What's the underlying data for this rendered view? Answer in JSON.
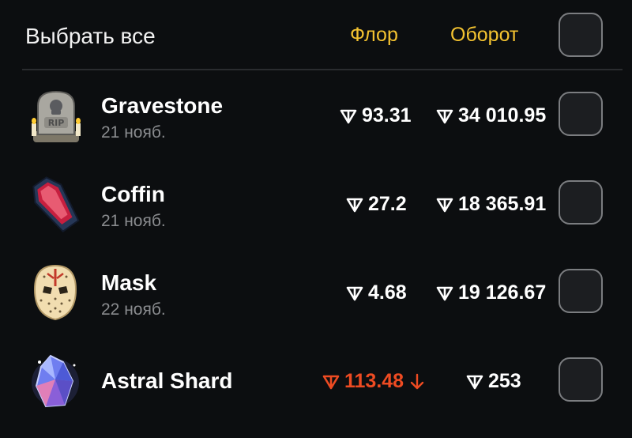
{
  "header": {
    "select_all_label": "Выбрать все",
    "col_floor_label": "Флор",
    "col_turnover_label": "Оборот"
  },
  "colors": {
    "background": "#0c0e10",
    "accent_header": "#f3c230",
    "negative": "#ee4b22",
    "muted": "#8a8c8f"
  },
  "currency_icon": "ton-icon",
  "items": [
    {
      "name": "Gravestone",
      "date": "21 нояб.",
      "floor": "93.31",
      "turnover": "34 010.95",
      "icon": "gravestone-icon",
      "trend": ""
    },
    {
      "name": "Coffin",
      "date": "21 нояб.",
      "floor": "27.2",
      "turnover": "18 365.91",
      "icon": "coffin-icon",
      "trend": ""
    },
    {
      "name": "Mask",
      "date": "22 нояб.",
      "floor": "4.68",
      "turnover": "19 126.67",
      "icon": "mask-icon",
      "trend": ""
    },
    {
      "name": "Astral Shard",
      "date": "",
      "floor": "113.48",
      "turnover": "253",
      "icon": "astral-shard-icon",
      "trend": "down"
    }
  ]
}
